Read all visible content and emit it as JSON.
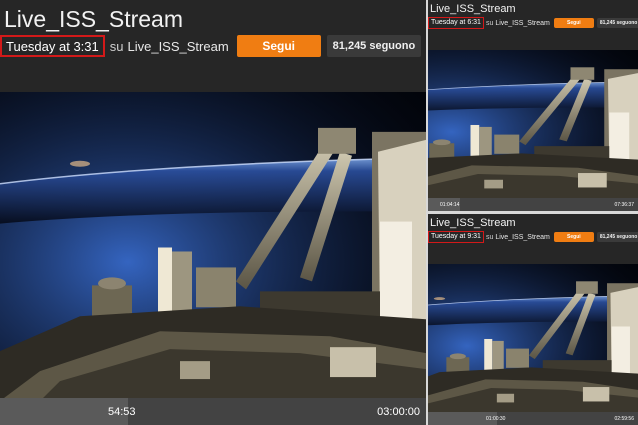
{
  "panels": [
    {
      "title": "Live_ISS_Stream",
      "time": "Tuesday at 3:31",
      "su": "su",
      "channel": "Live_ISS_Stream",
      "follow": "Segui",
      "followers": "81,245 seguono",
      "elapsed": "54:53",
      "duration": "03:00:00",
      "progress": 0.3
    },
    {
      "title": "Live_ISS_Stream",
      "time": "Tuesday at 6:31",
      "su": "su",
      "channel": "Live_ISS_Stream",
      "follow": "Segui",
      "followers": "81,245 seguono",
      "elapsed": "01:04:14",
      "duration": "07:36:37",
      "progress": 0.15
    },
    {
      "title": "Live_ISS_Stream",
      "time": "Tuesday at 9:31",
      "su": "su",
      "channel": "Live_ISS_Stream",
      "follow": "Segui",
      "followers": "81,245 seguono",
      "elapsed": "01:00:30",
      "duration": "02:59:56",
      "progress": 0.33
    }
  ],
  "colors": {
    "accent": "#f07d12",
    "highlight": "#d31919",
    "background": "#262626"
  }
}
